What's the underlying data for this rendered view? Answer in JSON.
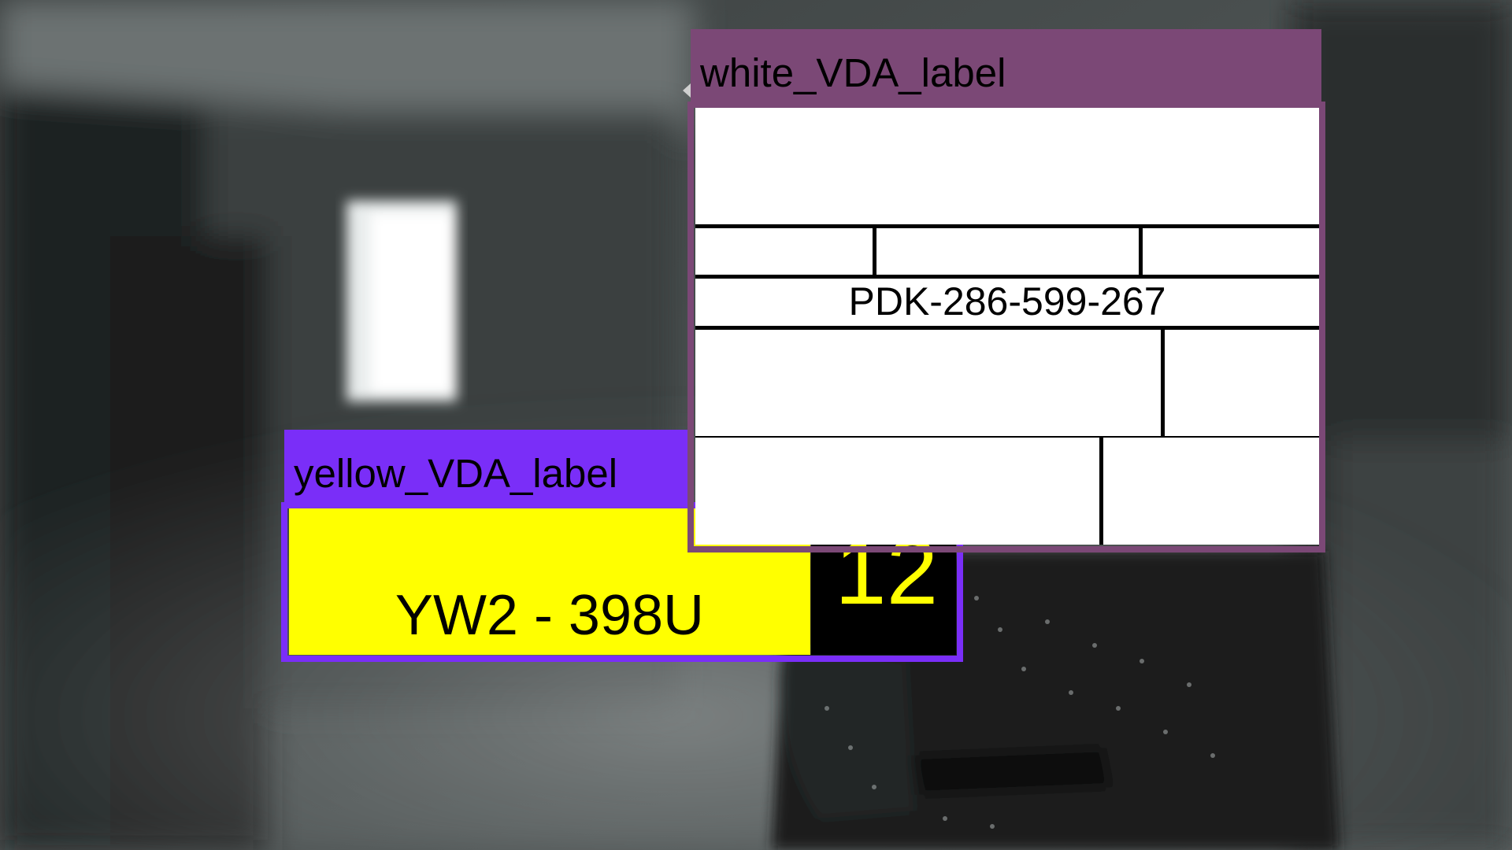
{
  "annotations": [
    {
      "label": "yellow_VDA_label",
      "color": "#7a2ef8",
      "plate": {
        "background": "#ffff00",
        "number": "YW2 - 398U",
        "badge_text": "12",
        "badge_background": "#000000",
        "badge_color": "#ffff00"
      }
    },
    {
      "label": "white_VDA_label",
      "color": "#7b4876",
      "plate": {
        "background": "#ffffff",
        "number": "PDK-286-599-267"
      }
    }
  ]
}
